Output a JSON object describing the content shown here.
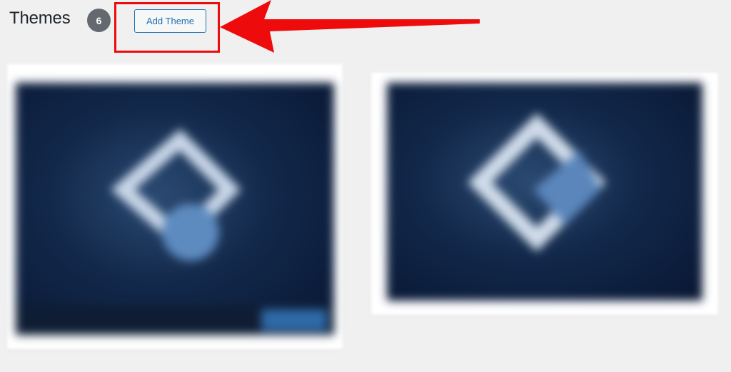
{
  "header": {
    "title": "Themes",
    "count": "6",
    "add_theme_label": "Add Theme"
  },
  "annotation": {
    "highlight_color": "#ee0b0b"
  },
  "themes": [
    {
      "name": ""
    },
    {
      "name": ""
    }
  ],
  "colors": {
    "background": "#f0f0f1",
    "accent": "#2271b1",
    "count_badge": "#646970"
  }
}
